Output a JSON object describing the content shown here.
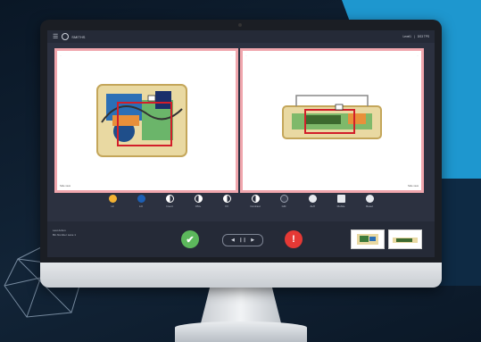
{
  "app": {
    "brand": "SMITHS"
  },
  "header": {
    "user": "Level1",
    "context": "DS3 TPS"
  },
  "panels": {
    "left_label": "Side view",
    "right_label": "Side view",
    "corner_marks": "··"
  },
  "tools": [
    {
      "label": "HI",
      "icon": "color-dot-icon",
      "color": "#f4b233"
    },
    {
      "label": "LO",
      "icon": "color-dot-icon",
      "color": "#1d5fb4"
    },
    {
      "label": "Invert",
      "icon": "half-circle-icon",
      "color": "#ffffff"
    },
    {
      "label": "OM+",
      "icon": "half-circle-icon",
      "color": "#ffffff"
    },
    {
      "label": "VV",
      "icon": "half-circle-icon",
      "color": "#ffffff"
    },
    {
      "label": "Contrast",
      "icon": "half-circle-icon",
      "color": "#ffffff"
    },
    {
      "label": "GM",
      "icon": "dark-circle-icon",
      "color": "#3b4152"
    },
    {
      "label": "Zeff",
      "icon": "outline-circle-icon",
      "color": "#e6e9ee"
    },
    {
      "label": "Mobile",
      "icon": "outline-square-icon",
      "color": "#e6e9ee"
    },
    {
      "label": "Reset",
      "icon": "reset-icon",
      "color": "#e6e9ee"
    }
  ],
  "bottom": {
    "info_line1": "Last Action",
    "info_line2": "Bin Number",
    "info_line3": "Lane 1",
    "accept_symbol": "✔",
    "reject_symbol": "!",
    "player_prev": "◀",
    "player_pause": "❙❙",
    "player_next": "▶"
  }
}
